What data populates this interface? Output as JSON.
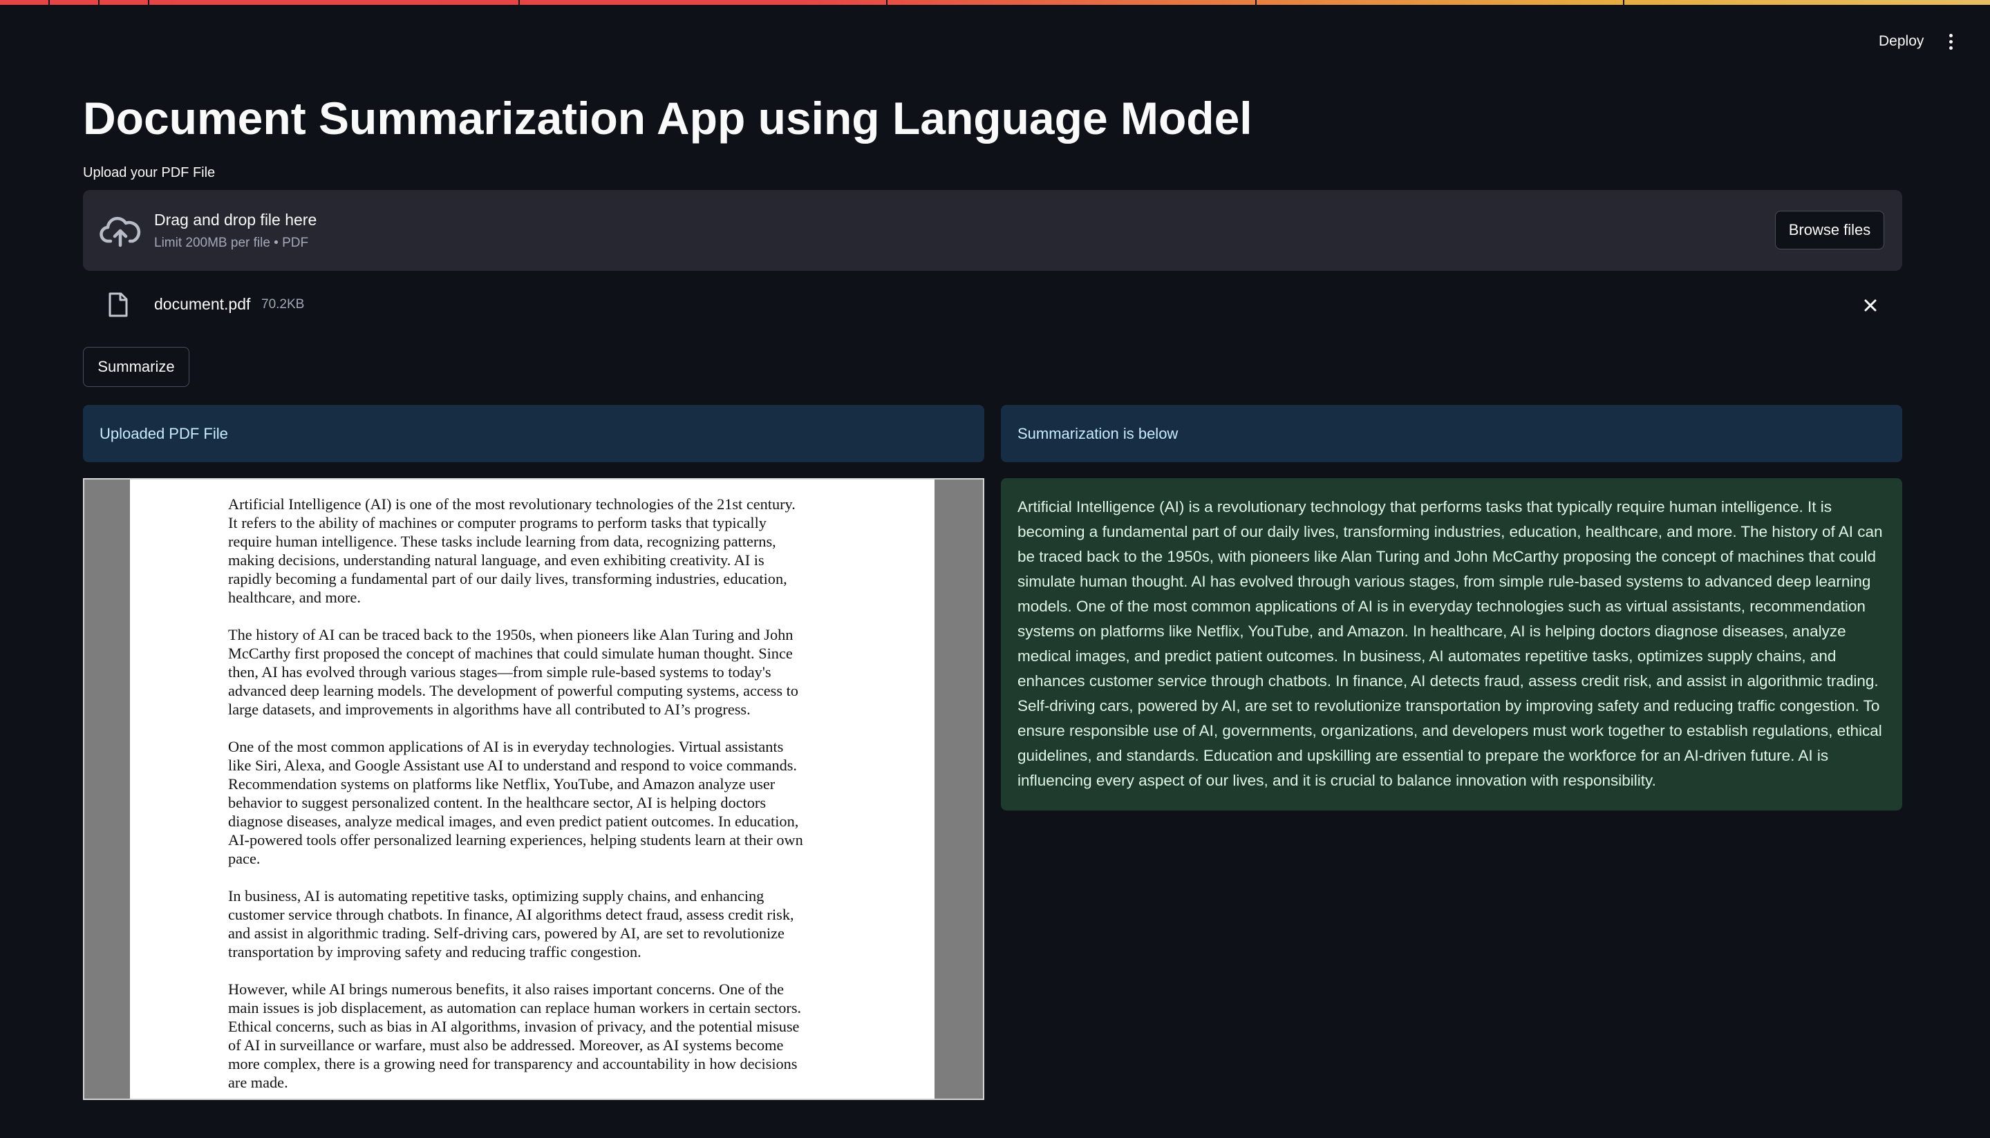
{
  "header": {
    "deploy_label": "Deploy",
    "menu_icon": "kebab-menu-icon"
  },
  "page": {
    "title": "Document Summarization App using Language Model"
  },
  "uploader": {
    "label": "Upload your PDF File",
    "drop_text": "Drag and drop file here",
    "limit_text": "Limit 200MB per file • PDF",
    "browse_label": "Browse files",
    "icon": "cloud-upload-icon"
  },
  "uploaded_file": {
    "name": "document.pdf",
    "size": "70.2KB",
    "icon": "file-icon",
    "remove_icon": "close-icon"
  },
  "actions": {
    "summarize_label": "Summarize"
  },
  "left_panel": {
    "heading": "Uploaded PDF File",
    "pdf_paragraphs": [
      "Artificial Intelligence (AI) is one of the most revolutionary technologies of the 21st century.\nIt refers to the ability of machines or computer programs to perform tasks that typically\nrequire human intelligence. These tasks include learning from data, recognizing patterns,\nmaking decisions, understanding natural language, and even exhibiting creativity. AI is\nrapidly becoming a fundamental part of our daily lives, transforming industries, education,\nhealthcare, and more.",
      "The history of AI can be traced back to the 1950s, when pioneers like Alan Turing and John\nMcCarthy first proposed the concept of machines that could simulate human thought. Since\nthen, AI has evolved through various stages—from simple rule-based systems to today's\nadvanced deep learning models. The development of powerful computing systems, access to\nlarge datasets, and improvements in algorithms have all contributed to AI’s progress.",
      "One of the most common applications of AI is in everyday technologies. Virtual assistants\nlike Siri, Alexa, and Google Assistant use AI to understand and respond to voice commands.\nRecommendation systems on platforms like Netflix, YouTube, and Amazon analyze user\nbehavior to suggest personalized content. In the healthcare sector, AI is helping doctors\ndiagnose diseases, analyze medical images, and even predict patient outcomes. In education,\nAI-powered tools offer personalized learning experiences, helping students learn at their own\npace.",
      "In business, AI is automating repetitive tasks, optimizing supply chains, and enhancing\ncustomer service through chatbots. In finance, AI algorithms detect fraud, assess credit risk,\nand assist in algorithmic trading. Self-driving cars, powered by AI, are set to revolutionize\ntransportation by improving safety and reducing traffic congestion.",
      "However, while AI brings numerous benefits, it also raises important concerns. One of the\nmain issues is job displacement, as automation can replace human workers in certain sectors.\nEthical concerns, such as bias in AI algorithms, invasion of privacy, and the potential misuse\nof AI in surveillance or warfare, must also be addressed. Moreover, as AI systems become\nmore complex, there is a growing need for transparency and accountability in how decisions\nare made."
    ]
  },
  "right_panel": {
    "heading": "Summarization is below",
    "summary": "Artificial Intelligence (AI) is a revolutionary technology that performs tasks that typically require human intelligence. It is becoming a fundamental part of our daily lives, transforming industries, education, healthcare, and more. The history of AI can be traced back to the 1950s, with pioneers like Alan Turing and John McCarthy proposing the concept of machines that could simulate human thought. AI has evolved through various stages, from simple rule-based systems to advanced deep learning models. One of the most common applications of AI is in everyday technologies such as virtual assistants, recommendation systems on platforms like Netflix, YouTube, and Amazon. In healthcare, AI is helping doctors diagnose diseases, analyze medical images, and predict patient outcomes. In business, AI automates repetitive tasks, optimizes supply chains, and enhances customer service through chatbots. In finance, AI detects fraud, assess credit risk, and assist in algorithmic trading. Self-driving cars, powered by AI, are set to revolutionize transportation by improving safety and reducing traffic congestion. To ensure responsible use of AI, governments, organizations, and developers must work together to establish regulations, ethical guidelines, and standards. Education and upskilling are essential to prepare the workforce for an AI-driven future. AI is influencing every aspect of our lives, and it is crucial to balance innovation with responsibility."
  },
  "colors": {
    "background": "#0e1117",
    "dropzone": "#262730",
    "info_box": "#172d43",
    "success_box": "#1f3b2d",
    "accent": "#ff4b4b"
  }
}
